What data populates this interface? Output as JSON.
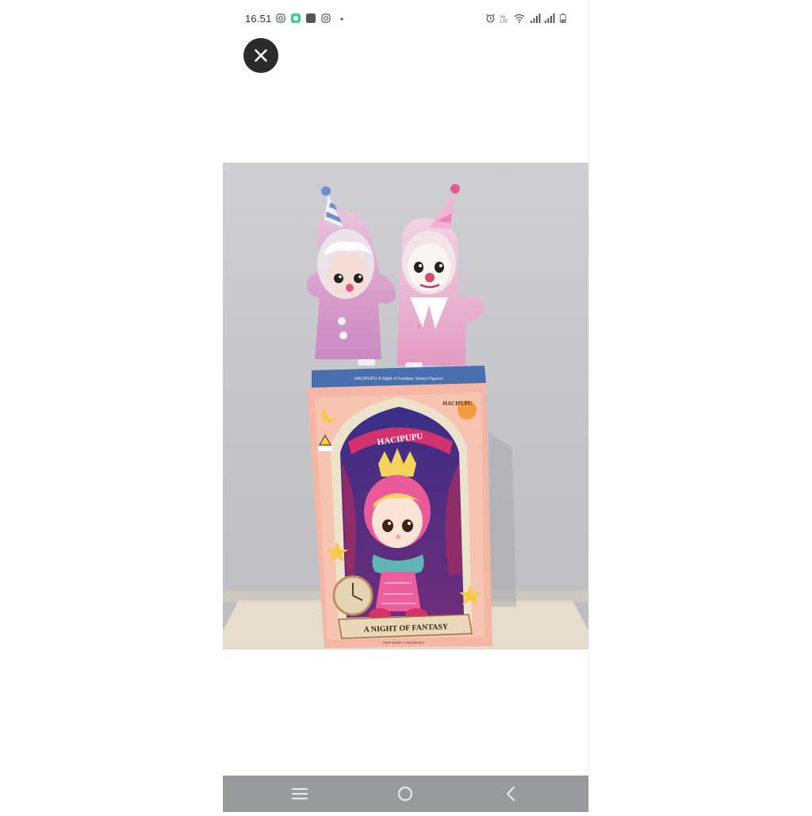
{
  "status_bar": {
    "time": "16.51"
  },
  "overlay": {
    "close_icon": "close-icon"
  },
  "photo": {
    "box_top_strip_text": "HACIPUPU A Night of Fantasy Series Figures",
    "box_banner_text": "HACIPUPU",
    "box_corner_text": "HACIPUPU",
    "box_scroll_text": "A NIGHT OF FANTASY",
    "box_bottom_text": "POP MART × HACIPUPU"
  },
  "nav_bar": {
    "recents_icon": "recents-icon",
    "home_icon": "home-icon",
    "back_icon": "back-icon"
  },
  "colors": {
    "nav_bg": "#999a9c",
    "close_bg": "#2b2b2b"
  }
}
